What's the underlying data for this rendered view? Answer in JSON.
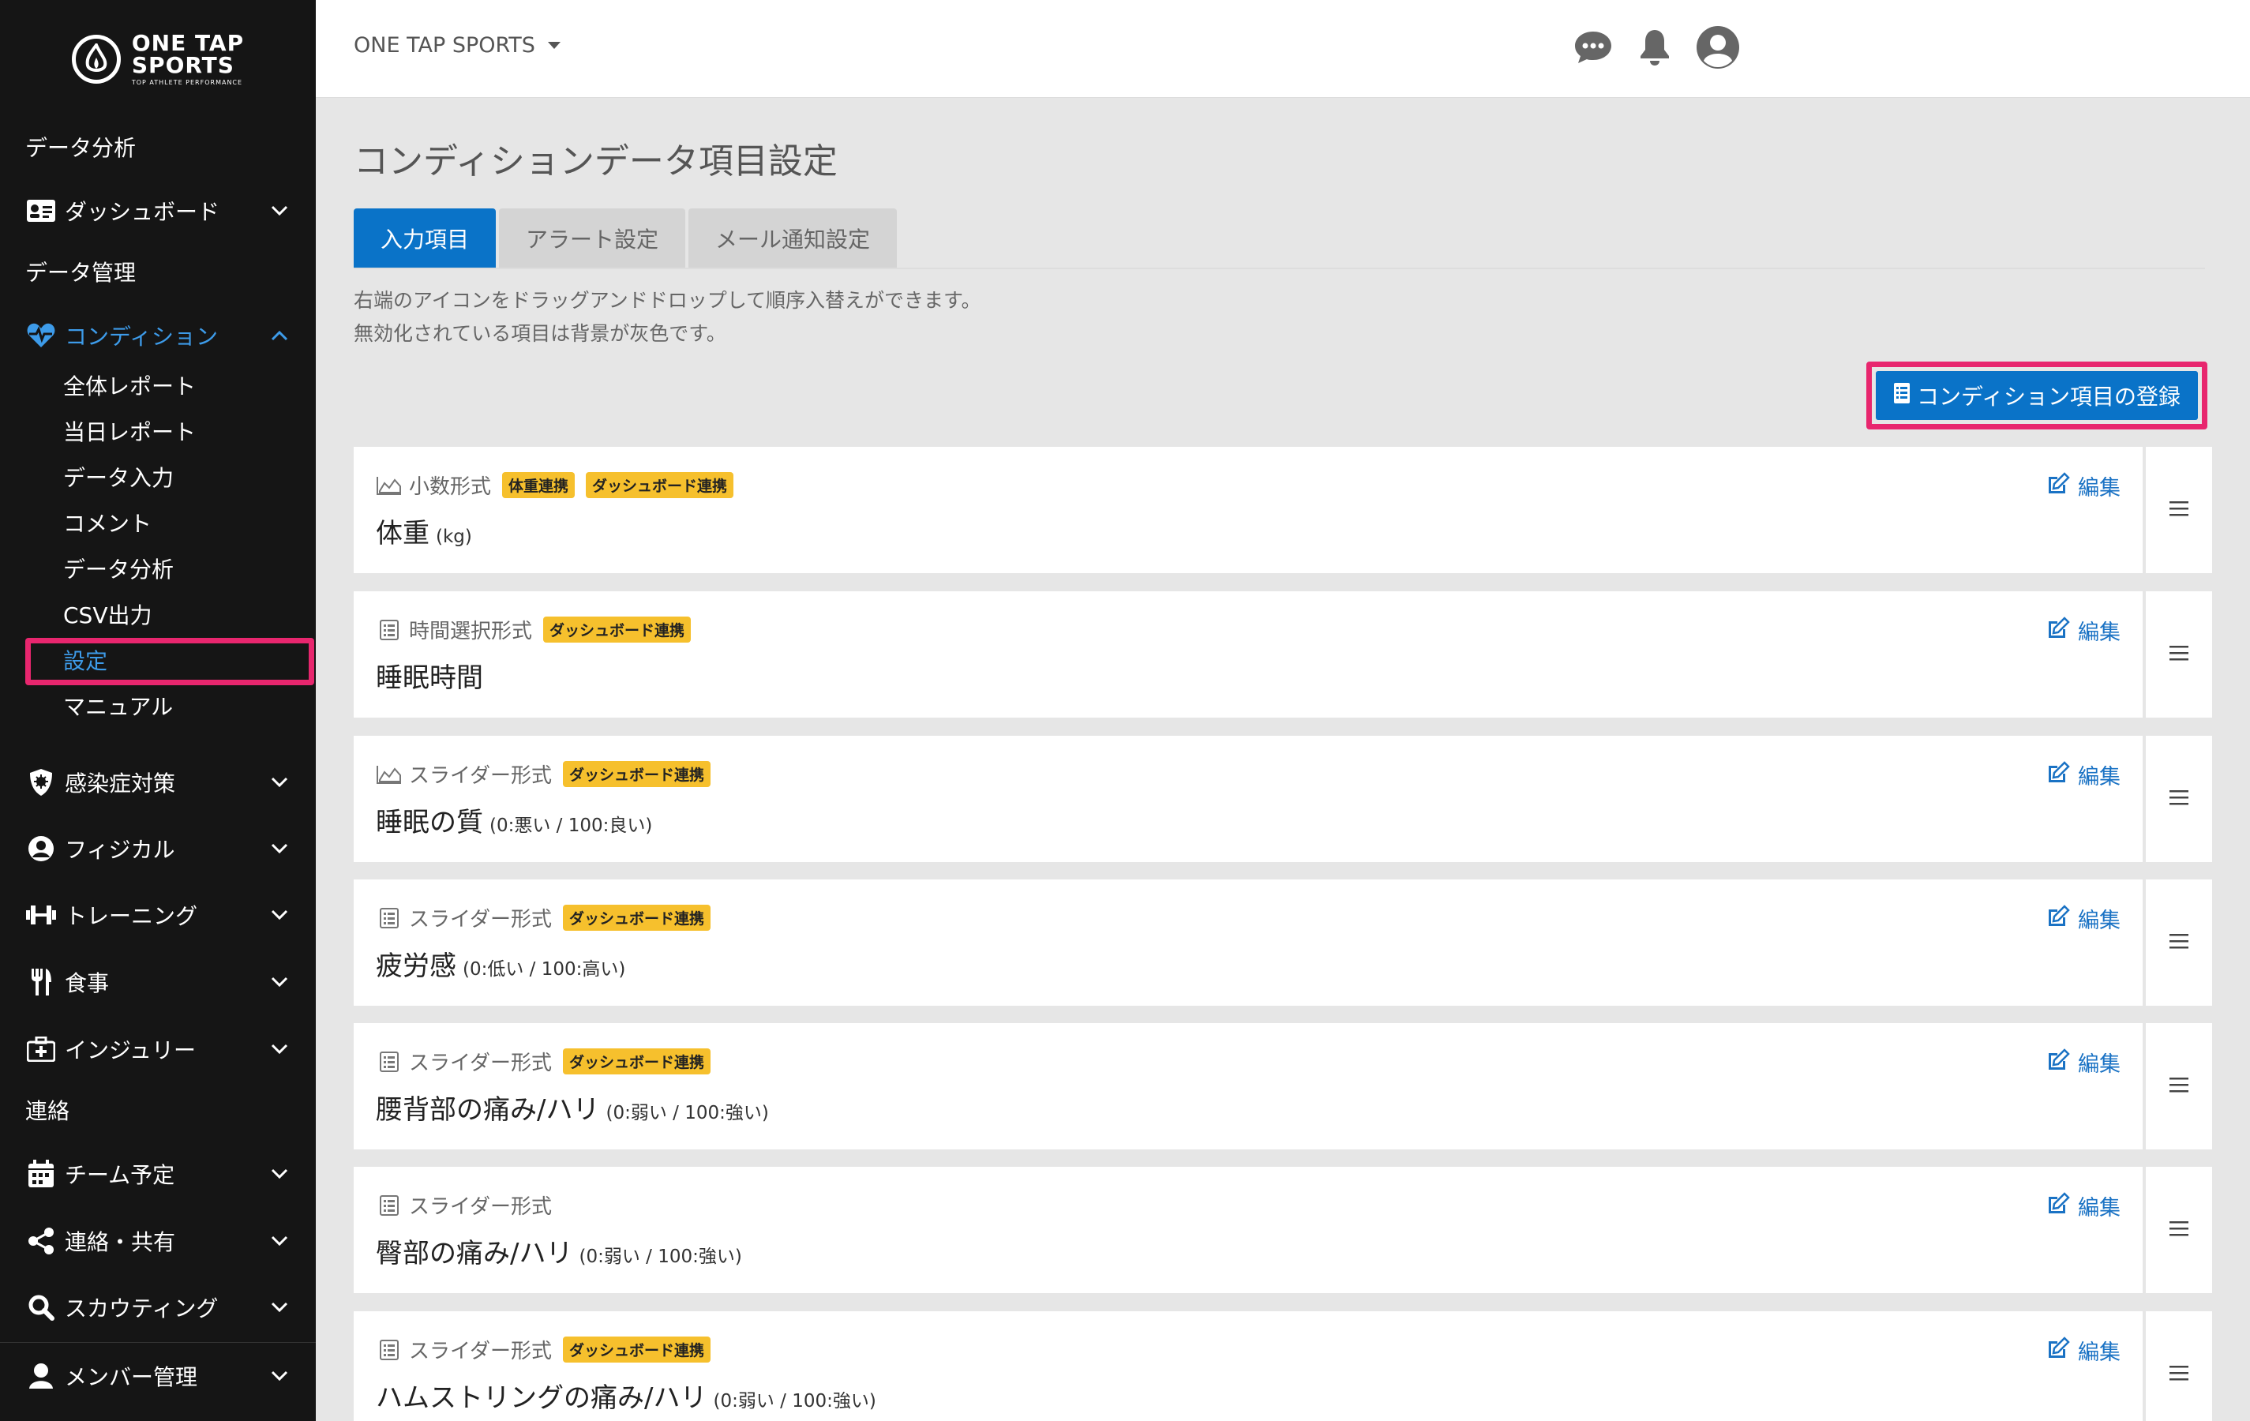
{
  "brand": {
    "line1": "ONE TAP",
    "line2": "SPORTS",
    "tagline": "TOP ATHLETE PERFORMANCE"
  },
  "header": {
    "team": "ONE TAP SPORTS"
  },
  "sidebar": {
    "data_analysis": "データ分析",
    "dashboard": "ダッシュボード",
    "data_management": "データ管理",
    "condition": "コンディション",
    "condition_items": [
      "全体レポート",
      "当日レポート",
      "データ入力",
      "コメント",
      "データ分析",
      "CSV出力",
      "設定",
      "マニュアル"
    ],
    "infection": "感染症対策",
    "physical": "フィジカル",
    "training": "トレーニング",
    "meal": "食事",
    "injury": "インジュリー",
    "contact": "連絡",
    "team_schedule": "チーム予定",
    "share": "連絡・共有",
    "scouting": "スカウティング",
    "member_management": "メンバー管理"
  },
  "page": {
    "title": "コンディションデータ項目設定",
    "tabs": [
      "入力項目",
      "アラート設定",
      "メール通知設定"
    ],
    "help_line1": "右端のアイコンをドラッグアンドドロップして順序入替えができます。",
    "help_line2": "無効化されている項目は背景が灰色です。",
    "register_button": "コンディション項目の登録",
    "edit_label": "編集"
  },
  "items": [
    {
      "type": "小数形式",
      "badges": [
        "体重連携",
        "ダッシュボード連携"
      ],
      "name": "体重",
      "unit": "(kg)"
    },
    {
      "type": "時間選択形式",
      "badges": [
        "ダッシュボード連携"
      ],
      "name": "睡眠時間",
      "unit": ""
    },
    {
      "type": "スライダー形式",
      "badges": [
        "ダッシュボード連携"
      ],
      "name": "睡眠の質",
      "unit": "(0:悪い / 100:良い)"
    },
    {
      "type": "スライダー形式",
      "badges": [
        "ダッシュボード連携"
      ],
      "name": "疲労感",
      "unit": "(0:低い / 100:高い)"
    },
    {
      "type": "スライダー形式",
      "badges": [
        "ダッシュボード連携"
      ],
      "name": "腰背部の痛み/ハリ",
      "unit": "(0:弱い / 100:強い)"
    },
    {
      "type": "スライダー形式",
      "badges": [],
      "name": "臀部の痛み/ハリ",
      "unit": "(0:弱い / 100:強い)"
    },
    {
      "type": "スライダー形式",
      "badges": [
        "ダッシュボード連携"
      ],
      "name": "ハムストリングの痛み/ハリ",
      "unit": "(0:弱い / 100:強い)"
    }
  ],
  "colors": {
    "primary": "#0a73c8",
    "highlight": "#e8266e",
    "badge": "#f6c02d",
    "sidebar": "#151515",
    "active_nav": "#3d9be9"
  }
}
